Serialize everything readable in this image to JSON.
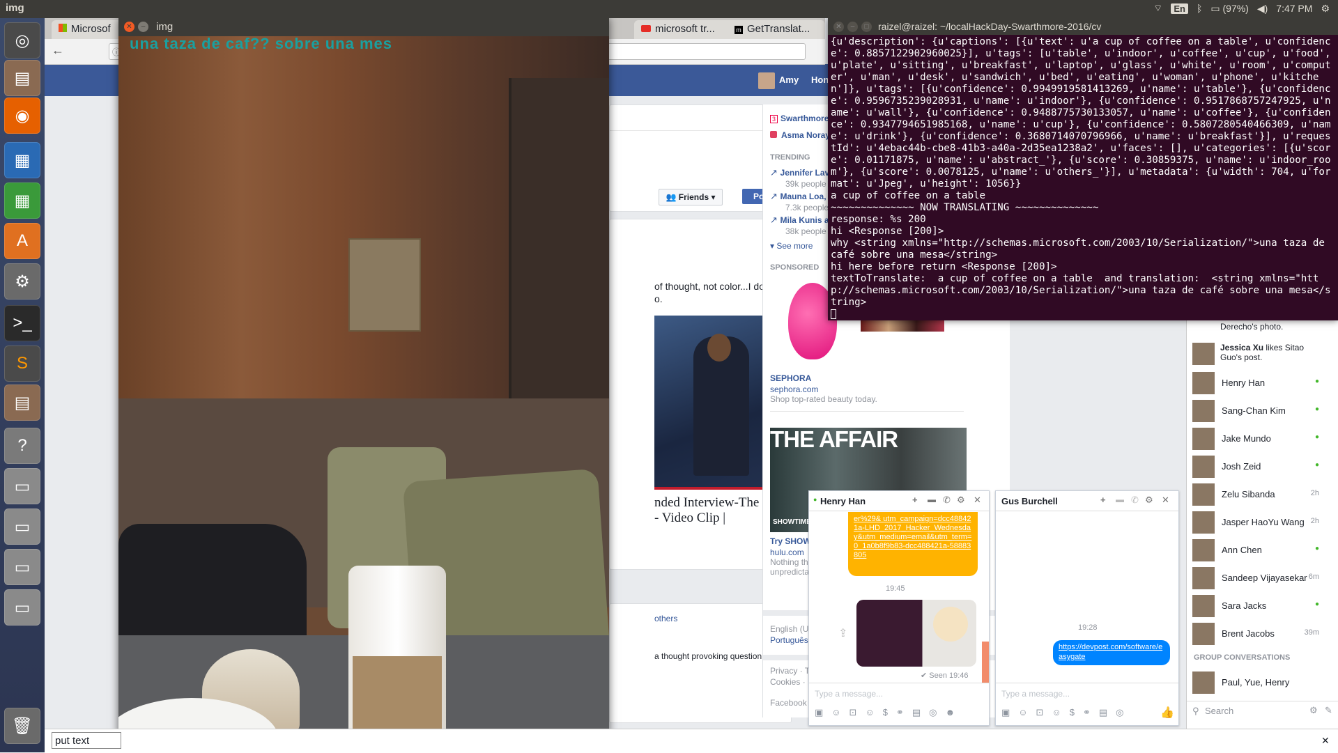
{
  "panel": {
    "app_name": "img",
    "input_method": "En",
    "battery": "(97%)",
    "clock": "7:47 PM"
  },
  "browser": {
    "tabs": [
      {
        "label": "Microsof"
      },
      {
        "label": "microsoft tr..."
      },
      {
        "label": "GetTranslat..."
      }
    ],
    "url_fragment": "htt"
  },
  "img_window": {
    "title": "img",
    "overlay_text": "una taza de caf?? sobre una mes"
  },
  "terminal": {
    "title": "raizel@raizel: ~/localHackDay-Swarthmore-2016/cv",
    "output": "{u'description': {u'captions': [{u'text': u'a cup of coffee on a table', u'confidence': 0.8857122902960025}], u'tags': [u'table', u'indoor', u'coffee', u'cup', u'food', u'plate', u'sitting', u'breakfast', u'laptop', u'glass', u'white', u'room', u'computer', u'man', u'desk', u'sandwich', u'bed', u'eating', u'woman', u'phone', u'kitchen']}, u'tags': [{u'confidence': 0.9949919581413269, u'name': u'table'}, {u'confidence': 0.9596735239028931, u'name': u'indoor'}, {u'confidence': 0.9517868757247925, u'name': u'wall'}, {u'confidence': 0.9488775730133057, u'name': u'coffee'}, {u'confidence': 0.9347794651985168, u'name': u'cup'}, {u'confidence': 0.5807280540466309, u'name': u'drink'}, {u'confidence': 0.3680714070796966, u'name': u'breakfast'}], u'requestId': u'4ebac44b-cbe8-41b3-a40a-2d35ea1238a2', u'faces': [], u'categories': [{u'score': 0.01171875, u'name': u'abstract_'}, {u'score': 0.30859375, u'name': u'indoor_room'}, {u'score': 0.0078125, u'name': u'others_'}], u'metadata': {u'width': 704, u'format': u'Jpeg', u'height': 1056}}\na cup of coffee on a table\n~~~~~~~~~~~~~~ NOW TRANSLATING ~~~~~~~~~~~~~~\nresponse: %s 200\nhi <Response [200]>\nwhy <string xmlns=\"http://schemas.microsoft.com/2003/10/Serialization/\">una taza de café sobre una mesa</string>\nhi here before return <Response [200]>\ntextToTranslate:  a cup of coffee on a table  and translation:  <string xmlns=\"http://schemas.microsoft.com/2003/10/Serialization/\">una taza de café sobre una mesa</string>"
  },
  "facebook": {
    "user_name": "Amy",
    "home_label": "Hon",
    "friends_button": "Friends",
    "post_button": "Post",
    "post_snippet": "of thought, not color...I don't",
    "post_snippet2": "o.",
    "video_title_line1": "nded Interview-The",
    "video_title_line2": "- Video Clip |",
    "others_link": "others",
    "comment_snippet": "a thought provoking question",
    "shortcuts": [
      {
        "label": "Swarthmore",
        "badge": "3"
      },
      {
        "label": "Asma Noray"
      }
    ],
    "trending_header": "TRENDING",
    "trending": [
      {
        "name": "Jennifer Lav",
        "count": "39k people"
      },
      {
        "name": "Mauna Loa,",
        "count": "7.3k people"
      },
      {
        "name": "Mila Kunis a",
        "count": "38k people"
      }
    ],
    "see_more": "See more",
    "sponsored_header": "SPONSORED",
    "ad1": {
      "brand": "SEPHORA",
      "url": "sephora.com",
      "text": "Shop top-rated beauty today."
    },
    "ad2": {
      "banner": "THE AFFAIR",
      "network": "SHOWTIME ON hu",
      "title": "Try SHOWT",
      "url": "hulu.com",
      "text1": "Nothing that",
      "text2": "unpredictab"
    },
    "languages": [
      "English (UK)",
      "Português (B"
    ],
    "footer": [
      "Privacy · Ter",
      "Cookies · Mo",
      "Facebook ©"
    ],
    "ticker": [
      {
        "text": "Derecho's photo."
      },
      {
        "name": "Jessica Xu",
        "text": " likes Sitao Guo's post."
      }
    ],
    "friends": [
      {
        "name": "Henry Han",
        "status": "●"
      },
      {
        "name": "Sang-Chan Kim",
        "status": "●"
      },
      {
        "name": "Jake Mundo",
        "status": "●"
      },
      {
        "name": "Josh Zeid",
        "status": "●"
      },
      {
        "name": "Zelu Sibanda",
        "status": "2h"
      },
      {
        "name": "Jasper HaoYu Wang",
        "status": "2h"
      },
      {
        "name": "Ann Chen",
        "status": "●"
      },
      {
        "name": "Sandeep Vijayasekar",
        "status": "6m"
      },
      {
        "name": "Sara Jacks",
        "status": "●"
      },
      {
        "name": "Brent Jacobs",
        "status": "39m"
      }
    ],
    "group_header": "GROUP CONVERSATIONS",
    "group": "Paul, Yue, Henry",
    "sidebar_search": "Search"
  },
  "chat1": {
    "name": "Henry Han",
    "message": "er%29&\nutm_campaign=dcc488421a-LHD_2017_Hacker_Wednesday&utm_medium=email&utm_term=0_1a0b8f9b83-dcc488421a-58883805",
    "time": "19:45",
    "seen": "✔ Seen 19:46",
    "placeholder": "Type a message..."
  },
  "chat2": {
    "name": "Gus Burchell",
    "time": "19:28",
    "link": "https://devpost.com/software/easygate",
    "placeholder": "Type a message..."
  },
  "put_text": {
    "value": "put text",
    "close": "✕"
  }
}
